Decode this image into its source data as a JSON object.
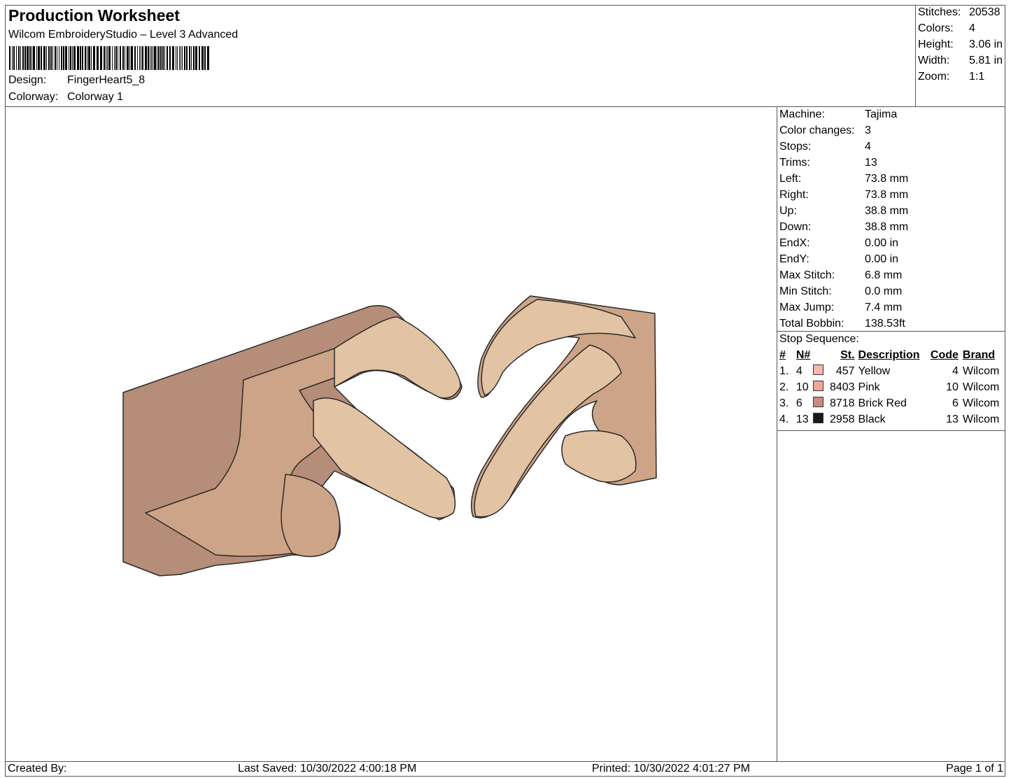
{
  "header": {
    "title": "Production Worksheet",
    "subtitle": "Wilcom EmbroideryStudio – Level 3 Advanced",
    "design_label": "Design:",
    "design_value": "FingerHeart5_8",
    "colorway_label": "Colorway:",
    "colorway_value": "Colorway 1"
  },
  "summary": {
    "stitches_label": "Stitches:",
    "stitches_value": "20538",
    "colors_label": "Colors:",
    "colors_value": "4",
    "height_label": "Height:",
    "height_value": "3.06 in",
    "width_label": "Width:",
    "width_value": "5.81 in",
    "zoom_label": "Zoom:",
    "zoom_value": "1:1"
  },
  "machine_info": [
    {
      "label": "Machine:",
      "value": "Tajima"
    },
    {
      "label": "Color changes:",
      "value": "3"
    },
    {
      "label": "Stops:",
      "value": "4"
    },
    {
      "label": "Trims:",
      "value": "13"
    },
    {
      "label": "Left:",
      "value": "73.8 mm"
    },
    {
      "label": "Right:",
      "value": "73.8 mm"
    },
    {
      "label": "Up:",
      "value": "38.8 mm"
    },
    {
      "label": "Down:",
      "value": "38.8 mm"
    },
    {
      "label": "EndX:",
      "value": "0.00 in"
    },
    {
      "label": "EndY:",
      "value": "0.00 in"
    },
    {
      "label": "Max Stitch:",
      "value": "6.8 mm"
    },
    {
      "label": "Min Stitch:",
      "value": "0.0 mm"
    },
    {
      "label": "Max Jump:",
      "value": "7.4 mm"
    },
    {
      "label": "Total Bobbin:",
      "value": "138.53ft"
    }
  ],
  "stop_sequence": {
    "title": "Stop Sequence:",
    "headers": {
      "seq": "#",
      "n": "N#",
      "st": "St.",
      "description": "Description",
      "code": "Code",
      "brand": "Brand"
    },
    "rows": [
      {
        "seq": "1.",
        "n": "4",
        "color": "#f4b8ae",
        "st": "457",
        "description": "Yellow",
        "code": "4",
        "brand": "Wilcom"
      },
      {
        "seq": "2.",
        "n": "10",
        "color": "#eaa894",
        "st": "8403",
        "description": "Pink",
        "code": "10",
        "brand": "Wilcom"
      },
      {
        "seq": "3.",
        "n": "6",
        "color": "#c98a80",
        "st": "8718",
        "description": "Brick Red",
        "code": "6",
        "brand": "Wilcom"
      },
      {
        "seq": "4.",
        "n": "13",
        "color": "#1a1a1a",
        "st": "2958",
        "description": "Black",
        "code": "13",
        "brand": "Wilcom"
      }
    ]
  },
  "design_colors": {
    "light": "#e2c3a3",
    "mid": "#cda487",
    "dark": "#b58d78",
    "outline": "#2a2a2a"
  },
  "footer": {
    "created_by": "Created By:",
    "last_saved": "Last Saved: 10/30/2022 4:00:18 PM",
    "printed": "Printed: 10/30/2022 4:01:27 PM",
    "page": "Page 1 of 1"
  }
}
